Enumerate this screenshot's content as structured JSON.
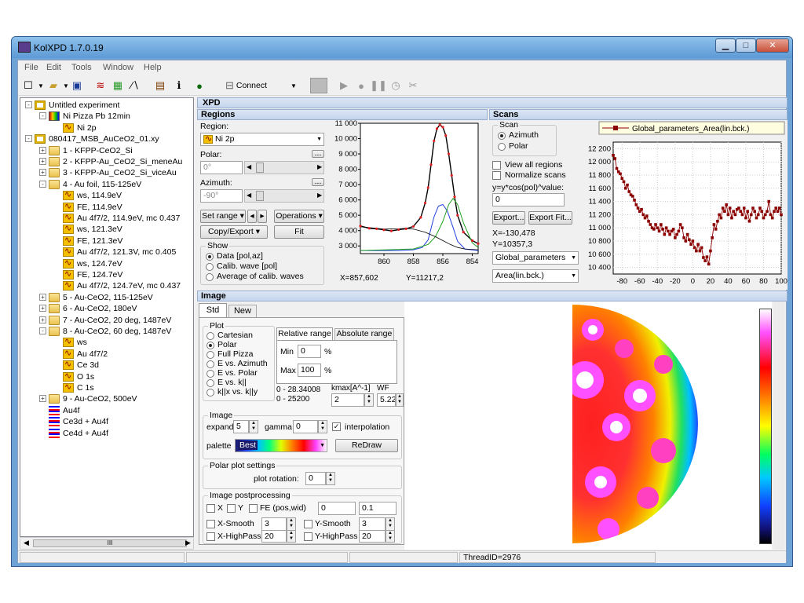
{
  "window": {
    "title": "KolXPD 1.7.0.19",
    "min": "▁",
    "max": "□",
    "close": "✕"
  },
  "menu": [
    "File",
    "Edit",
    "Tools",
    "Window",
    "Help"
  ],
  "toolbar": {
    "connect": "Connect"
  },
  "tree": [
    {
      "label": "Untitled experiment",
      "lvl": 0,
      "icon": "experiment-icon",
      "exp": "-"
    },
    {
      "label": "Ni Pizza Pb 12min",
      "lvl": 1,
      "icon": "scan-image-icon",
      "exp": "-"
    },
    {
      "label": "Ni 2p",
      "lvl": 2,
      "icon": "spectrum-icon"
    },
    {
      "label": "080417_MSB_AuCeO2_01.xy",
      "lvl": 0,
      "icon": "experiment-icon",
      "exp": "-"
    },
    {
      "label": "1 - KFPP-CeO2_Si",
      "lvl": 1,
      "icon": "folder-icon",
      "exp": "+"
    },
    {
      "label": "2 - KFPP-Au_CeO2_Si_meneAu",
      "lvl": 1,
      "icon": "folder-icon",
      "exp": "+"
    },
    {
      "label": "3 - KFPP-Au_CeO2_Si_viceAu",
      "lvl": 1,
      "icon": "folder-icon",
      "exp": "+"
    },
    {
      "label": "4 - Au foil, 115-125eV",
      "lvl": 1,
      "icon": "folder-icon",
      "exp": "-"
    },
    {
      "label": "ws, 114.9eV",
      "lvl": 2,
      "icon": "spectrum-icon"
    },
    {
      "label": "FE, 114.9eV",
      "lvl": 2,
      "icon": "spectrum-icon"
    },
    {
      "label": "Au 4f7/2, 114.9eV, mc 0.437",
      "lvl": 2,
      "icon": "spectrum-icon"
    },
    {
      "label": "ws, 121.3eV",
      "lvl": 2,
      "icon": "spectrum-icon"
    },
    {
      "label": "FE, 121.3eV",
      "lvl": 2,
      "icon": "spectrum-icon"
    },
    {
      "label": "Au 4f7/2, 121.3V, mc 0.405",
      "lvl": 2,
      "icon": "spectrum-icon"
    },
    {
      "label": "ws, 124.7eV",
      "lvl": 2,
      "icon": "spectrum-icon"
    },
    {
      "label": "FE, 124.7eV",
      "lvl": 2,
      "icon": "spectrum-icon"
    },
    {
      "label": "Au 4f7/2, 124.7eV, mc 0.437",
      "lvl": 2,
      "icon": "spectrum-icon"
    },
    {
      "label": "5 - Au-CeO2, 115-125eV",
      "lvl": 1,
      "icon": "folder-icon",
      "exp": "+"
    },
    {
      "label": "6 - Au-CeO2, 180eV",
      "lvl": 1,
      "icon": "folder-icon",
      "exp": "+"
    },
    {
      "label": "7 - Au-CeO2, 20 deg, 1487eV",
      "lvl": 1,
      "icon": "folder-icon",
      "exp": "+"
    },
    {
      "label": "8 - Au-CeO2, 60 deg, 1487eV",
      "lvl": 1,
      "icon": "folder-icon",
      "exp": "-"
    },
    {
      "label": "ws",
      "lvl": 2,
      "icon": "spectrum-icon"
    },
    {
      "label": "Au 4f7/2",
      "lvl": 2,
      "icon": "spectrum-icon"
    },
    {
      "label": "Ce 3d",
      "lvl": 2,
      "icon": "spectrum-icon"
    },
    {
      "label": "O 1s",
      "lvl": 2,
      "icon": "spectrum-icon"
    },
    {
      "label": "C 1s",
      "lvl": 2,
      "icon": "spectrum-icon"
    },
    {
      "label": "9 - Au-CeO2, 500eV",
      "lvl": 1,
      "icon": "folder-icon",
      "exp": "+"
    },
    {
      "label": "Au4f",
      "lvl": 1,
      "icon": "multiplot-icon"
    },
    {
      "label": "Ce3d + Au4f",
      "lvl": 1,
      "icon": "multiplot-icon"
    },
    {
      "label": "Ce4d + Au4f",
      "lvl": 1,
      "icon": "multiplot-icon"
    }
  ],
  "xpd": {
    "header": "XPD"
  },
  "regions": {
    "header": "Regions",
    "region_label": "Region:",
    "region_value": "Ni 2p",
    "polar_label": "Polar:",
    "polar_value": "0°",
    "azimuth_label": "Azimuth:",
    "azimuth_value": "-90°",
    "dots": "...",
    "set_range": "Set range",
    "operations": "Operations",
    "copy_export": "Copy/Export",
    "fit": "Fit",
    "show_label": "Show",
    "show_opts": [
      "Data [pol,az]",
      "Calib. wave [pol]",
      "Average of calib. waves"
    ],
    "cursor_x": "X=857,602",
    "cursor_y": "Y=11217,2"
  },
  "scans": {
    "header": "Scans",
    "scan_label": "Scan",
    "azimuth": "Azimuth",
    "polar": "Polar",
    "view_all": "View all regions",
    "normalize": "Normalize scans",
    "formula": "y=y*cos(pol)^value:",
    "formula_value": "0",
    "export": "Export...",
    "export_fit": "Export Fit...",
    "cursor_x": "X=-130,478",
    "cursor_y": "Y=10357,3",
    "param_select": "Global_parameters",
    "area_select": "Area(lin.bck.)",
    "legend": "Global_parameters_Area(lin.bck.)"
  },
  "image": {
    "header": "Image",
    "tab_std": "Std",
    "tab_new": "New",
    "plot_label": "Plot",
    "plot_opts": [
      "Cartesian",
      "Polar",
      "Full Pizza",
      "E vs. Azimuth",
      "E vs. Polar",
      "E vs. k||",
      "k||x vs. k||y"
    ],
    "rel_range": "Relative range",
    "abs_range": "Absolute range",
    "min_label": "Min",
    "min_value": "0",
    "max_label": "Max",
    "max_value": "100",
    "pct": "%",
    "range1": "0 - 28.34008",
    "range2": "0 - 25200",
    "kmax_label": "kmax[A^-1]",
    "kmax_value": "2",
    "wf_label": "WF",
    "wf_value": "5.22",
    "image_group": "Image",
    "expand_label": "expand",
    "expand_value": "5",
    "gamma_label": "gamma",
    "gamma_value": "0",
    "interp_label": "interpolation",
    "palette_label": "palette",
    "palette_value": "Best",
    "redraw": "ReDraw",
    "polar_settings": "Polar plot settings",
    "rotation_label": "plot rotation:",
    "rotation_value": "0",
    "postproc": "Image postprocessing",
    "x": "X",
    "y": "Y",
    "fe": "FE (pos,wid)",
    "fe_pos": "0",
    "fe_wid": "0.1",
    "xsmooth": "X-Smooth",
    "xsmooth_v": "3",
    "ysmooth": "Y-Smooth",
    "ysmooth_v": "3",
    "xhp": "X-HighPass",
    "xhp_v": "20",
    "yhp": "Y-HighPass",
    "yhp_v": "20"
  },
  "status": {
    "thread": "ThreadID=2976"
  },
  "hscroll": "III",
  "chart_data": [
    {
      "type": "line",
      "series": [
        {
          "values": [
            [
              861.6,
              4300
            ],
            [
              861.0,
              4150
            ],
            [
              860.5,
              4120
            ],
            [
              860.0,
              4050
            ],
            [
              859.5,
              3980
            ],
            [
              859.0,
              4060
            ],
            [
              858.5,
              4120
            ],
            [
              858.0,
              4270
            ],
            [
              857.5,
              4860
            ],
            [
              857.2,
              5800
            ],
            [
              857.0,
              6800
            ],
            [
              856.8,
              8300
            ],
            [
              856.6,
              9850
            ],
            [
              856.4,
              10650
            ],
            [
              856.2,
              10900
            ],
            [
              856.0,
              10750
            ],
            [
              855.8,
              10200
            ],
            [
              855.6,
              9000
            ],
            [
              855.4,
              7600
            ],
            [
              855.2,
              6200
            ],
            [
              855.0,
              5000
            ],
            [
              854.6,
              3900
            ],
            [
              854.0,
              3350
            ],
            [
              853.6,
              3150
            ]
          ]
        },
        {
          "values": [
            [
              861.6,
              2700
            ],
            [
              860.0,
              2700
            ],
            [
              859.0,
              2700
            ],
            [
              858.0,
              2750
            ],
            [
              857.4,
              2900
            ],
            [
              857.0,
              3400
            ],
            [
              856.6,
              4900
            ],
            [
              856.3,
              5600
            ],
            [
              856.0,
              5700
            ],
            [
              855.7,
              5300
            ],
            [
              855.3,
              4200
            ],
            [
              855.0,
              3300
            ],
            [
              854.5,
              2800
            ],
            [
              853.6,
              2700
            ]
          ]
        },
        {
          "values": [
            [
              861.6,
              2700
            ],
            [
              858.0,
              2800
            ],
            [
              857.0,
              3100
            ],
            [
              856.5,
              3600
            ],
            [
              856.0,
              4600
            ],
            [
              855.6,
              5700
            ],
            [
              855.3,
              6100
            ],
            [
              855.0,
              5700
            ],
            [
              854.6,
              4500
            ],
            [
              854.0,
              3200
            ],
            [
              853.6,
              2900
            ]
          ]
        },
        {
          "values": [
            [
              861.6,
              4250
            ],
            [
              860.0,
              4100
            ],
            [
              859.0,
              4120
            ],
            [
              858.5,
              4150
            ],
            [
              858.0,
              4100
            ],
            [
              857.2,
              3900
            ],
            [
              856.5,
              3600
            ],
            [
              856.0,
              3350
            ],
            [
              855.5,
              3100
            ],
            [
              855.0,
              2900
            ],
            [
              854.5,
              2800
            ],
            [
              853.6,
              2750
            ]
          ]
        }
      ],
      "xlim": [
        861.6,
        853.6
      ],
      "ylim": [
        2500,
        11000
      ],
      "xticks": [
        860,
        858,
        856,
        854
      ],
      "yticks": [
        "11 000",
        "10 000",
        "9 000",
        "8 000",
        "7 000",
        "6 000",
        "5 000",
        "4 000",
        "3 000"
      ]
    },
    {
      "type": "line",
      "series": [
        {
          "name": "Global_parameters_Area(lin.bck.)",
          "values": [
            [
              -90,
              12100
            ],
            [
              -88,
              12050
            ],
            [
              -86,
              11900
            ],
            [
              -84,
              11850
            ],
            [
              -82,
              11820
            ],
            [
              -80,
              11750
            ],
            [
              -78,
              11700
            ],
            [
              -76,
              11600
            ],
            [
              -74,
              11650
            ],
            [
              -72,
              11550
            ],
            [
              -70,
              11500
            ],
            [
              -68,
              11480
            ],
            [
              -66,
              11420
            ],
            [
              -64,
              11350
            ],
            [
              -62,
              11300
            ],
            [
              -60,
              11250
            ],
            [
              -58,
              11280
            ],
            [
              -56,
              11200
            ],
            [
              -54,
              11150
            ],
            [
              -52,
              11180
            ],
            [
              -50,
              11100
            ],
            [
              -48,
              11050
            ],
            [
              -46,
              11000
            ],
            [
              -44,
              10980
            ],
            [
              -42,
              11050
            ],
            [
              -40,
              11000
            ],
            [
              -38,
              10950
            ],
            [
              -36,
              11050
            ],
            [
              -34,
              10980
            ],
            [
              -32,
              10900
            ],
            [
              -30,
              11000
            ],
            [
              -28,
              10950
            ],
            [
              -26,
              10900
            ],
            [
              -24,
              10950
            ],
            [
              -22,
              10980
            ],
            [
              -20,
              10850
            ],
            [
              -18,
              10900
            ],
            [
              -16,
              10950
            ],
            [
              -14,
              11050
            ],
            [
              -12,
              11000
            ],
            [
              -10,
              10850
            ],
            [
              -8,
              10800
            ],
            [
              -6,
              10900
            ],
            [
              -4,
              10820
            ],
            [
              -2,
              10750
            ],
            [
              0,
              10800
            ],
            [
              2,
              10700
            ],
            [
              4,
              10650
            ],
            [
              6,
              10750
            ],
            [
              8,
              10650
            ],
            [
              10,
              10700
            ],
            [
              12,
              10550
            ],
            [
              14,
              10500
            ],
            [
              16,
              10560
            ],
            [
              18,
              10450
            ],
            [
              20,
              10650
            ],
            [
              22,
              10850
            ],
            [
              24,
              11050
            ],
            [
              26,
              10980
            ],
            [
              28,
              11100
            ],
            [
              30,
              11200
            ],
            [
              32,
              11150
            ],
            [
              34,
              11300
            ],
            [
              36,
              11250
            ],
            [
              38,
              11350
            ],
            [
              40,
              11200
            ],
            [
              42,
              11300
            ],
            [
              44,
              11150
            ],
            [
              46,
              11250
            ],
            [
              48,
              11200
            ],
            [
              50,
              11280
            ],
            [
              52,
              11300
            ],
            [
              54,
              11250
            ],
            [
              56,
              11200
            ],
            [
              58,
              11300
            ],
            [
              60,
              11150
            ],
            [
              62,
              11250
            ],
            [
              64,
              11100
            ],
            [
              66,
              11200
            ],
            [
              68,
              11300
            ],
            [
              70,
              11250
            ],
            [
              72,
              11150
            ],
            [
              74,
              11200
            ],
            [
              76,
              11300
            ],
            [
              78,
              11250
            ],
            [
              80,
              11150
            ],
            [
              82,
              11200
            ],
            [
              84,
              11250
            ],
            [
              86,
              11400
            ],
            [
              88,
              11200
            ],
            [
              90,
              11150
            ],
            [
              92,
              11250
            ],
            [
              94,
              11300
            ],
            [
              96,
              11250
            ],
            [
              98,
              11300
            ],
            [
              100,
              11200
            ]
          ]
        }
      ],
      "xlim": [
        -90,
        100
      ],
      "ylim": [
        10300,
        12300
      ],
      "xticks": [
        -80,
        -60,
        -40,
        -20,
        0,
        20,
        40,
        60,
        80,
        100
      ],
      "yticks": [
        "12 200",
        "12 000",
        "11 800",
        "11 600",
        "11 400",
        "11 200",
        "11 000",
        "10 800",
        "10 600",
        "10 400"
      ]
    }
  ]
}
